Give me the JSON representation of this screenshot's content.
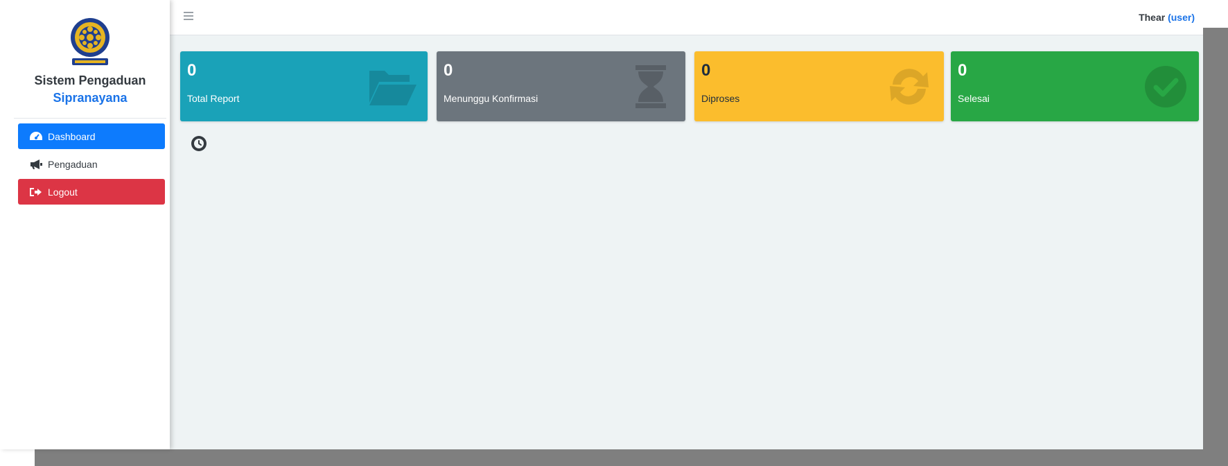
{
  "brand": {
    "name": "Sistem Pengaduan",
    "subtitle": "Sipranayana"
  },
  "nav": {
    "items": [
      {
        "label": "Dashboard",
        "icon": "tachometer-icon",
        "state": "active"
      },
      {
        "label": "Pengaduan",
        "icon": "megaphone-icon",
        "state": "normal"
      },
      {
        "label": "Logout",
        "icon": "sign-out-icon",
        "state": "danger"
      }
    ]
  },
  "topbar": {
    "user_name": "Thear",
    "user_role": "(user)"
  },
  "cards": [
    {
      "value": "0",
      "label": "Total Report",
      "icon": "folder-open-icon",
      "color": "#1aa2b8"
    },
    {
      "value": "0",
      "label": "Menunggu Konfirmasi",
      "icon": "hourglass-icon",
      "color": "#6c757d"
    },
    {
      "value": "0",
      "label": "Diproses",
      "icon": "refresh-icon",
      "color": "#fbbd2d"
    },
    {
      "value": "0",
      "label": "Selesai",
      "icon": "check-circle-icon",
      "color": "#28a745"
    }
  ],
  "colors": {
    "accent": "#1a73e8",
    "active": "#0d7bfd",
    "danger": "#dc3545"
  }
}
